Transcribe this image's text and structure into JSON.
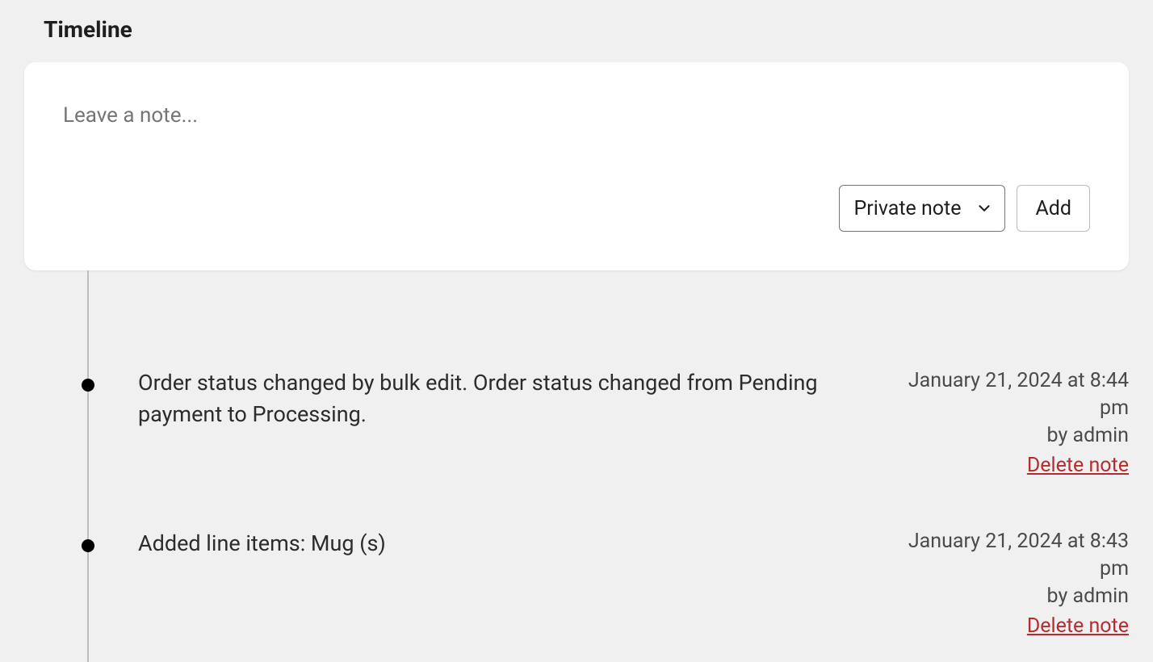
{
  "section_title": "Timeline",
  "note_box": {
    "placeholder": "Leave a note...",
    "value": "",
    "type_select": "Private note",
    "add_label": "Add"
  },
  "entries": [
    {
      "text": "Order status changed by bulk edit. Order status changed from Pending payment to Processing.",
      "meta_date": "January 21, 2024 at 8:44 pm",
      "meta_by": "by admin",
      "delete": "Delete note"
    },
    {
      "text": "Added line items: Mug (s)",
      "meta_date": "January 21, 2024 at 8:43 pm",
      "meta_by": "by admin",
      "delete": "Delete note"
    }
  ]
}
